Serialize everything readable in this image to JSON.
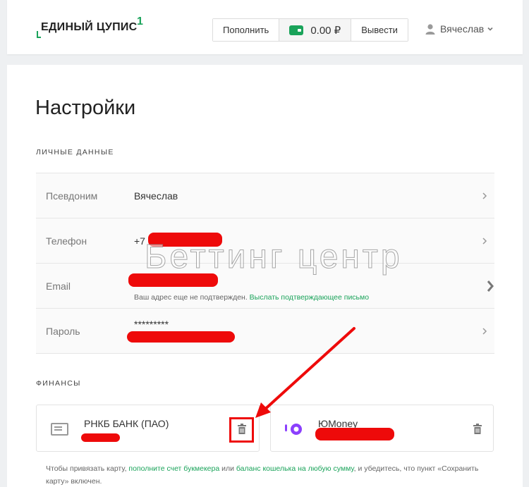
{
  "header": {
    "logo": "ЕДИНЫЙ ЦУПИС",
    "logo_sup": "1",
    "deposit_label": "Пополнить",
    "balance": "0.00 ₽",
    "withdraw_label": "Вывести",
    "user_name": "Вячеслав"
  },
  "page": {
    "title": "Настройки"
  },
  "personal": {
    "section_label": "ЛИЧНЫЕ ДАННЫЕ",
    "rows": [
      {
        "label": "Псевдоним",
        "value": "Вячеслав"
      },
      {
        "label": "Телефон",
        "value": "+7"
      },
      {
        "label": "Email",
        "value": "",
        "note": "Ваш адрес еще не подтвержден.",
        "note_link": "Выслать подтверждающее письмо"
      },
      {
        "label": "Пароль",
        "value": "*********"
      }
    ]
  },
  "finance": {
    "section_label": "ФИНАНСЫ",
    "cards": [
      {
        "name": "РНКБ БАНК (ПАО)"
      },
      {
        "name": "ЮMoney"
      }
    ],
    "footnote_part1": "Чтобы привязать карту, ",
    "footnote_link1": "пополните счет букмекера",
    "footnote_part2": " или ",
    "footnote_link2": "баланс кошелька на любую сумму",
    "footnote_part3": ", и убедитесь, что пункт «Сохранить карту» включен."
  },
  "watermark": "Беттинг центр",
  "colors": {
    "brand": "#1aa35a",
    "redaction": "#ee0a0a"
  }
}
